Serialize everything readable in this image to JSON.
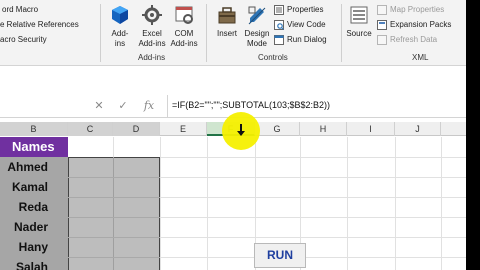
{
  "ribbon": {
    "code_group": {
      "record_macro": "ord Macro",
      "relative_references": "e Relative References",
      "macro_security": "acro Security"
    },
    "addins_group": {
      "addins": [
        "Add-",
        "ins"
      ],
      "excel_addins": [
        "Excel",
        "Add-ins"
      ],
      "com_addins": [
        "COM",
        "Add-ins"
      ],
      "label": "Add-ins"
    },
    "controls_group": {
      "insert": "Insert",
      "design_mode": [
        "Design",
        "Mode"
      ],
      "properties": "Properties",
      "view_code": "View Code",
      "run_dialog": "Run Dialog",
      "label": "Controls"
    },
    "xml_group": {
      "source": "Source",
      "map_properties": "Map Properties",
      "expansion_packs": "Expansion Packs",
      "refresh_data": "Refresh Data",
      "label": "XML"
    }
  },
  "formula_bar": {
    "formula": "=IF(B2=\"\";\"\";SUBTOTAL(103;$B$2:B2))"
  },
  "columns": [
    "B",
    "C",
    "D",
    "E",
    "F",
    "G",
    "H",
    "I",
    "J"
  ],
  "active_column": "F",
  "table": {
    "header": "Names",
    "names": [
      "Ahmed",
      "Kamal",
      "Reda",
      "Nader",
      "Hany",
      "Salah"
    ]
  },
  "run_button": "RUN",
  "colors": {
    "header_fill": "#7030a0",
    "name_fill": "#a6a6a6",
    "accent": "#217346",
    "highlight": "#f6f000",
    "run_text": "#1f3f9f"
  },
  "icons": [
    "addins-icon",
    "excel-addins-gear-icon",
    "com-addins-icon",
    "insert-toolbox-icon",
    "design-mode-icon",
    "properties-icon",
    "view-code-icon",
    "run-dialog-icon",
    "source-icon",
    "map-properties-icon",
    "expansion-packs-icon",
    "refresh-data-icon",
    "cancel-x-icon",
    "enter-check-icon",
    "fx-icon",
    "mouse-cursor-icon"
  ]
}
